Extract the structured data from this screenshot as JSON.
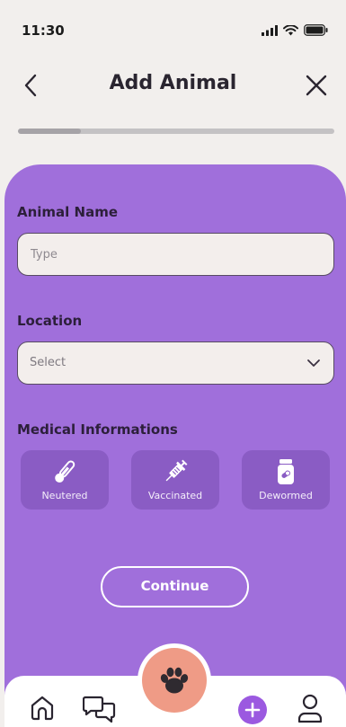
{
  "status_bar": {
    "time": "11:30"
  },
  "header": {
    "title": "Add Animal"
  },
  "progress": {
    "fraction": 0.2
  },
  "form": {
    "animal_name": {
      "label": "Animal Name",
      "placeholder": "Type",
      "value": ""
    },
    "location": {
      "label": "Location",
      "selected": "Select"
    },
    "medical": {
      "label": "Medical Informations",
      "options": [
        {
          "label": "Neutered",
          "icon": "thermometer-icon"
        },
        {
          "label": "Vaccinated",
          "icon": "syringe-icon"
        },
        {
          "label": "Dewormed",
          "icon": "pill-bottle-icon"
        }
      ]
    },
    "continue_label": "Continue"
  },
  "tabbar": {
    "items": [
      "home-icon",
      "chat-icon",
      "paw-icon",
      "plus-icon",
      "profile-icon"
    ]
  },
  "colors": {
    "panel": "#a06fdb",
    "card": "#8a5cc4",
    "fab": "#ef9b86",
    "accent": "#9b59e0"
  }
}
